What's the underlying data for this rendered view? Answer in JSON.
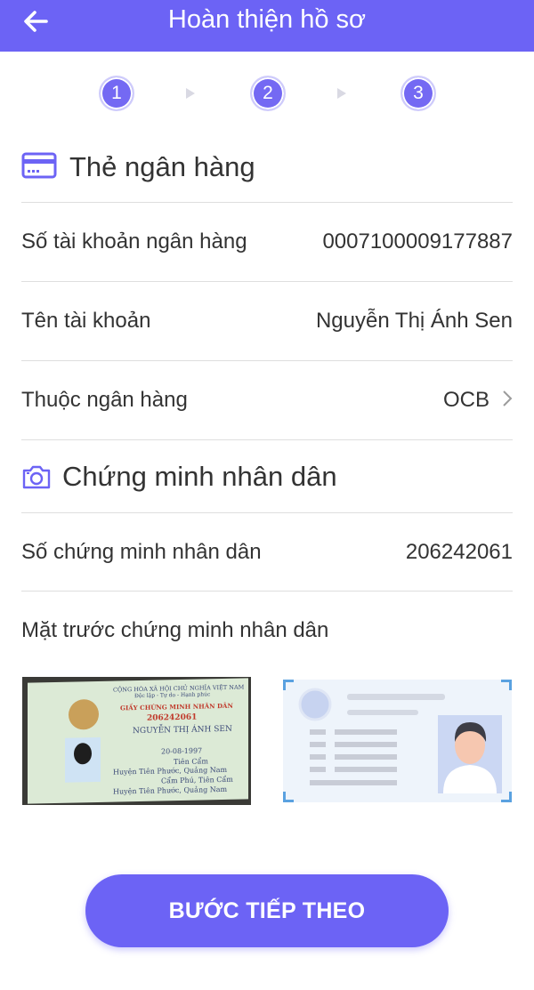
{
  "header": {
    "title": "Hoàn thiện hồ sơ"
  },
  "stepper": {
    "steps": [
      "1",
      "2",
      "3"
    ]
  },
  "bank_section": {
    "title": "Thẻ ngân hàng",
    "rows": [
      {
        "label": "Số tài khoản ngân hàng",
        "value": "0007100009177887"
      },
      {
        "label": "Tên tài khoản",
        "value": "Nguyễn Thị Ánh Sen"
      },
      {
        "label": "Thuộc ngân hàng",
        "value": "OCB"
      }
    ]
  },
  "id_section": {
    "title": "Chứng minh nhân dân",
    "number_label": "Số chứng minh nhân dân",
    "number_value": "206242061",
    "front_label": "Mặt trước chứng minh nhân dân",
    "card": {
      "country": "CỘNG HÒA XÃ HỘI CHỦ NGHĨA VIỆT NAM",
      "motto": "Độc lập - Tự do - Hạnh phúc",
      "doc_title": "GIẤY CHỨNG MINH NHÂN DÂN",
      "number": "206242061",
      "name": "NGUYỄN THỊ ÁNH SEN",
      "dob": "20-08-1997",
      "origin": "Tiên Cẩm",
      "origin_2": "Huyện Tiên Phước, Quảng Nam",
      "residence": "Cẩm Phú, Tiên Cẩm",
      "residence_2": "Huyện Tiên Phước, Quảng Nam"
    }
  },
  "actions": {
    "next_label": "BƯỚC TIẾP THEO"
  },
  "colors": {
    "primary": "#6c63f5",
    "divider": "#dedede",
    "accent_blue": "#5aa1e0"
  }
}
